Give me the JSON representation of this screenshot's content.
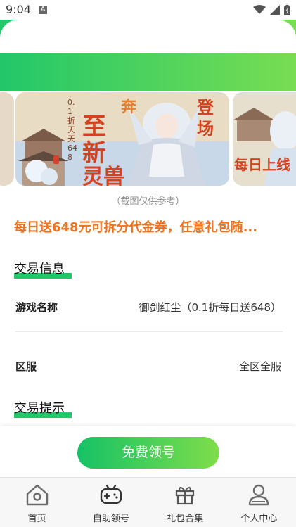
{
  "status_bar": {
    "time": "9:04",
    "notification_letter": "A"
  },
  "banner": {
    "main_image_name": "game-promo-art",
    "vertical_text": "0.1折天天648",
    "caption": "（截图仅供参考）"
  },
  "promo": {
    "title": "每日送648元可拆分代金券，任意礼包随..."
  },
  "sections": {
    "trade_info": "交易信息",
    "trade_tips": "交易提示"
  },
  "info_rows": [
    {
      "label": "游戏名称",
      "value": "御剑红尘（0.1折每日送648）"
    },
    {
      "label": "区服",
      "value": "全区全服"
    }
  ],
  "cta": {
    "label": "免费领号"
  },
  "nav": {
    "items": [
      {
        "label": "首页",
        "icon": "home-icon"
      },
      {
        "label": "自助领号",
        "icon": "gamepad-icon"
      },
      {
        "label": "礼包合集",
        "icon": "gift-icon"
      },
      {
        "label": "个人中心",
        "icon": "user-icon"
      }
    ]
  },
  "colors": {
    "accent_green": "#22c76a",
    "promo_orange": "#f2711c"
  }
}
